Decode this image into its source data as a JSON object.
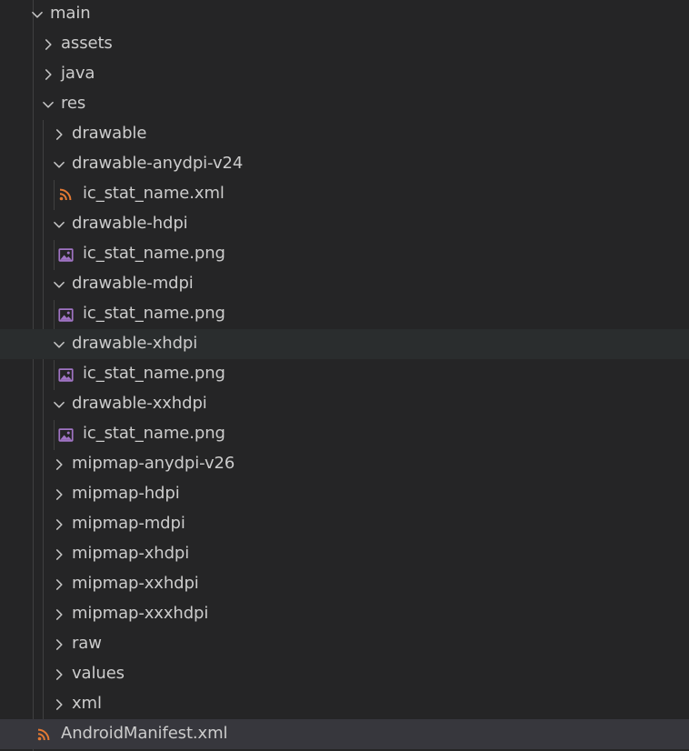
{
  "explorer": {
    "items": [
      {
        "label": "main",
        "kind": "folder",
        "expanded": true,
        "depth": 0,
        "icon": "chevron-down-icon"
      },
      {
        "label": "assets",
        "kind": "folder",
        "expanded": false,
        "depth": 1,
        "icon": "chevron-right-icon"
      },
      {
        "label": "java",
        "kind": "folder",
        "expanded": false,
        "depth": 1,
        "icon": "chevron-right-icon"
      },
      {
        "label": "res",
        "kind": "folder",
        "expanded": true,
        "depth": 1,
        "icon": "chevron-down-icon"
      },
      {
        "label": "drawable",
        "kind": "folder",
        "expanded": false,
        "depth": 2,
        "icon": "chevron-right-icon"
      },
      {
        "label": "drawable-anydpi-v24",
        "kind": "folder",
        "expanded": true,
        "depth": 2,
        "icon": "chevron-down-icon"
      },
      {
        "label": "ic_stat_name.xml",
        "kind": "file",
        "fileType": "xml",
        "depth": 3,
        "icon": "rss-file-icon"
      },
      {
        "label": "drawable-hdpi",
        "kind": "folder",
        "expanded": true,
        "depth": 2,
        "icon": "chevron-down-icon"
      },
      {
        "label": "ic_stat_name.png",
        "kind": "file",
        "fileType": "image",
        "depth": 3,
        "icon": "image-file-icon"
      },
      {
        "label": "drawable-mdpi",
        "kind": "folder",
        "expanded": true,
        "depth": 2,
        "icon": "chevron-down-icon"
      },
      {
        "label": "ic_stat_name.png",
        "kind": "file",
        "fileType": "image",
        "depth": 3,
        "icon": "image-file-icon"
      },
      {
        "label": "drawable-xhdpi",
        "kind": "folder",
        "expanded": true,
        "depth": 2,
        "icon": "chevron-down-icon",
        "state": "hover"
      },
      {
        "label": "ic_stat_name.png",
        "kind": "file",
        "fileType": "image",
        "depth": 3,
        "icon": "image-file-icon"
      },
      {
        "label": "drawable-xxhdpi",
        "kind": "folder",
        "expanded": true,
        "depth": 2,
        "icon": "chevron-down-icon"
      },
      {
        "label": "ic_stat_name.png",
        "kind": "file",
        "fileType": "image",
        "depth": 3,
        "icon": "image-file-icon"
      },
      {
        "label": "mipmap-anydpi-v26",
        "kind": "folder",
        "expanded": false,
        "depth": 2,
        "icon": "chevron-right-icon"
      },
      {
        "label": "mipmap-hdpi",
        "kind": "folder",
        "expanded": false,
        "depth": 2,
        "icon": "chevron-right-icon"
      },
      {
        "label": "mipmap-mdpi",
        "kind": "folder",
        "expanded": false,
        "depth": 2,
        "icon": "chevron-right-icon"
      },
      {
        "label": "mipmap-xhdpi",
        "kind": "folder",
        "expanded": false,
        "depth": 2,
        "icon": "chevron-right-icon"
      },
      {
        "label": "mipmap-xxhdpi",
        "kind": "folder",
        "expanded": false,
        "depth": 2,
        "icon": "chevron-right-icon"
      },
      {
        "label": "mipmap-xxxhdpi",
        "kind": "folder",
        "expanded": false,
        "depth": 2,
        "icon": "chevron-right-icon"
      },
      {
        "label": "raw",
        "kind": "folder",
        "expanded": false,
        "depth": 2,
        "icon": "chevron-right-icon"
      },
      {
        "label": "values",
        "kind": "folder",
        "expanded": false,
        "depth": 2,
        "icon": "chevron-right-icon"
      },
      {
        "label": "xml",
        "kind": "folder",
        "expanded": false,
        "depth": 2,
        "icon": "chevron-right-icon"
      },
      {
        "label": "AndroidManifest.xml",
        "kind": "file",
        "fileType": "xml",
        "depth": 1,
        "icon": "rss-file-icon",
        "state": "selected"
      }
    ]
  },
  "colors": {
    "background": "#252526",
    "text": "#cccccc",
    "chevron": "#c5c5c5",
    "hover": "#2a2d2e",
    "selected": "#37373d",
    "indent_guide": "#404040",
    "xml_icon": "#e37933",
    "image_icon": "#a074c4"
  }
}
